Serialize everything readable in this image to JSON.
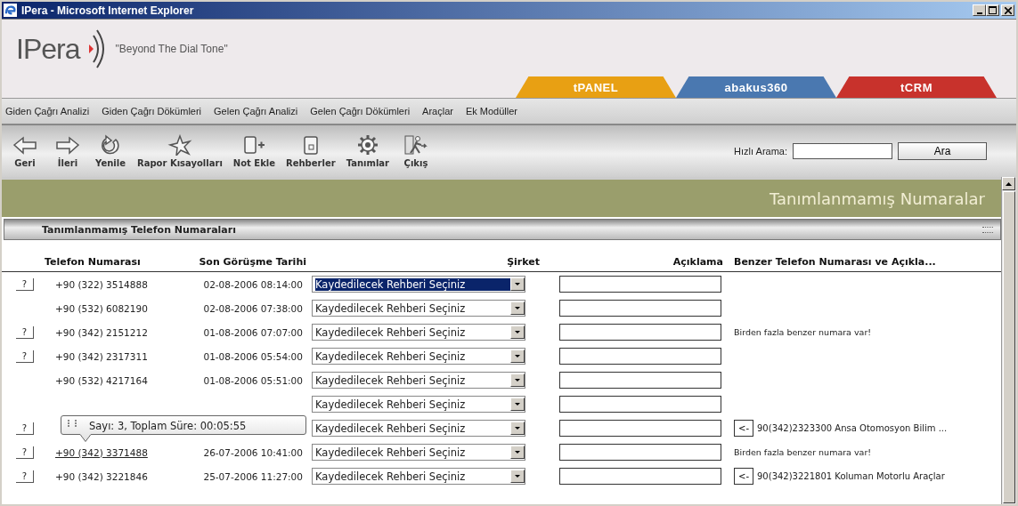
{
  "window": {
    "title": "IPera - Microsoft Internet Explorer"
  },
  "header": {
    "logo": "IPera",
    "slogan": "\"Beyond The Dial Tone\"",
    "product_tabs": [
      {
        "label": "tPANEL",
        "color": "#e8a013"
      },
      {
        "label": "abakus**360**",
        "color": "#4a78b0"
      },
      {
        "label": "tCRM",
        "color": "#c8322c"
      }
    ]
  },
  "menu": [
    "Giden Çağrı Analizi",
    "Giden Çağrı Dökümleri",
    "Gelen Çağrı Analizi",
    "Gelen Çağrı Dökümleri",
    "Araçlar",
    "Ek Modüller"
  ],
  "toolbar": {
    "buttons": [
      {
        "label": "Geri",
        "kind": "back"
      },
      {
        "label": "İleri",
        "kind": "forward"
      },
      {
        "label": "Yenile",
        "kind": "refresh"
      },
      {
        "label": "Rapor Kısayolları",
        "kind": "shortcuts"
      },
      {
        "label": "Not Ekle",
        "kind": "note"
      },
      {
        "label": "Rehberler",
        "kind": "book"
      },
      {
        "label": "Tanımlar",
        "kind": "gear"
      },
      {
        "label": "Çıkış",
        "kind": "exit"
      }
    ],
    "quick_search": {
      "label": "Hızlı Arama:",
      "button": "Ara"
    }
  },
  "banner": {
    "title": "Tanımlanmamış Numaralar"
  },
  "section": {
    "title": "Tanımlanmamış Telefon Numaraları"
  },
  "table": {
    "columns": [
      "Telefon Numarası",
      "Son Görüşme Tarihi",
      "Şirket",
      "Açıklama",
      "Benzer Telefon Numarası ve Açıkla..."
    ],
    "rows": [
      {
        "help": "?",
        "phone": "+90 (322) 3514888",
        "date": "02-08-2006 08:14:00",
        "company": "Kaydedilecek Rehberi Seçiniz",
        "focused": true,
        "similar": {
          "kind": "none"
        }
      },
      {
        "phone": "+90 (532) 6082190",
        "date": "02-08-2006 07:38:00",
        "company": "Kaydedilecek Rehberi Seçiniz",
        "focused": false,
        "similar": {
          "kind": "none"
        }
      },
      {
        "help": "?",
        "phone": "+90 (342) 2151212",
        "date": "01-08-2006 07:07:00",
        "company": "Kaydedilecek Rehberi Seçiniz",
        "focused": false,
        "similar": {
          "kind": "note",
          "text": "Birden fazla benzer numara var!"
        }
      },
      {
        "help": "?",
        "phone": "+90 (342) 2317311",
        "date": "01-08-2006 05:54:00",
        "company": "Kaydedilecek Rehberi Seçiniz",
        "focused": false,
        "similar": {
          "kind": "none"
        }
      },
      {
        "phone": "+90 (532) 4217164",
        "date": "01-08-2006 05:51:00",
        "company": "Kaydedilecek Rehberi Seçiniz",
        "focused": false,
        "similar": {
          "kind": "none"
        }
      },
      {
        "company": "Kaydedilecek Rehberi Seçiniz",
        "focused": false,
        "similar": {
          "kind": "none"
        }
      },
      {
        "help": "?",
        "company": "Kaydedilecek Rehberi Seçiniz",
        "focused": false,
        "similar": {
          "kind": "match",
          "button": "<-",
          "text": "90(342)2323300 Ansa Otomosyon Bilim ..."
        }
      },
      {
        "help": "?",
        "phone": "+90 (342) 3371488",
        "hovered": true,
        "date": "26-07-2006 10:41:00",
        "company": "Kaydedilecek Rehberi Seçiniz",
        "focused": false,
        "similar": {
          "kind": "note",
          "text": "Birden fazla benzer numara var!"
        }
      },
      {
        "help": "?",
        "phone": "+90 (342) 3221846",
        "date": "25-07-2006 11:27:00",
        "company": "Kaydedilecek Rehberi Seçiniz",
        "focused": false,
        "similar": {
          "kind": "match",
          "button": "<-",
          "text": "90(342)3221801 Koluman Motorlu Araçlar"
        }
      }
    ]
  },
  "tooltip": {
    "text": "Sayı: 3, Toplam Süre: 00:05:55"
  }
}
